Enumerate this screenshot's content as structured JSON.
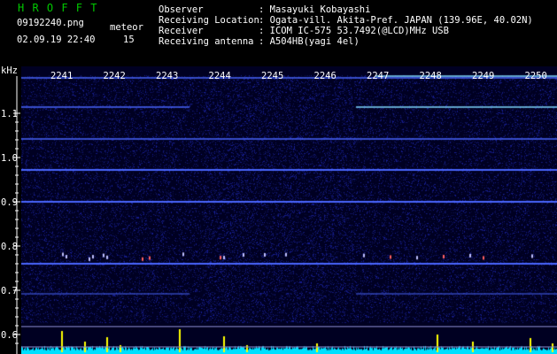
{
  "header": {
    "app_title": "H R O F F T",
    "filename": "09192240.png",
    "datetime": "02.09.19 22:40",
    "meteor_label": "meteor",
    "meteor_count": "15",
    "info_labels": [
      "Observer",
      "Receiving Location",
      "Receiver",
      "Receiving antenna"
    ],
    "info_values": [
      ": Masayuki Kobayashi",
      ": Ogata-vill. Akita-Pref. JAPAN (139.96E, 40.02N)",
      ": ICOM IC-575 53.7492(@LCD)MHz USB",
      ": A504HB(yagi 4el)"
    ]
  },
  "axis": {
    "unit_label": "kHz",
    "tick_labels": [
      "1.1",
      "1.0",
      "0.9",
      "0.8",
      "0.7",
      "0.6"
    ],
    "tick_values": [
      1.1,
      1.0,
      0.9,
      0.8,
      0.7,
      0.6
    ]
  },
  "minute_labels": [
    "2241",
    "2242",
    "2243",
    "2244",
    "2245",
    "2246",
    "2247",
    "2248",
    "2249",
    "2250"
  ],
  "colors": {
    "background": "#000022",
    "title_green": "#00c800",
    "text_white": "#ffffff",
    "carrier_blue": "#4a66ff",
    "carrier_cyan": "#7fd8ff",
    "meteor_yellow": "#ffff00",
    "level_cyan": "#00e0ff"
  }
}
